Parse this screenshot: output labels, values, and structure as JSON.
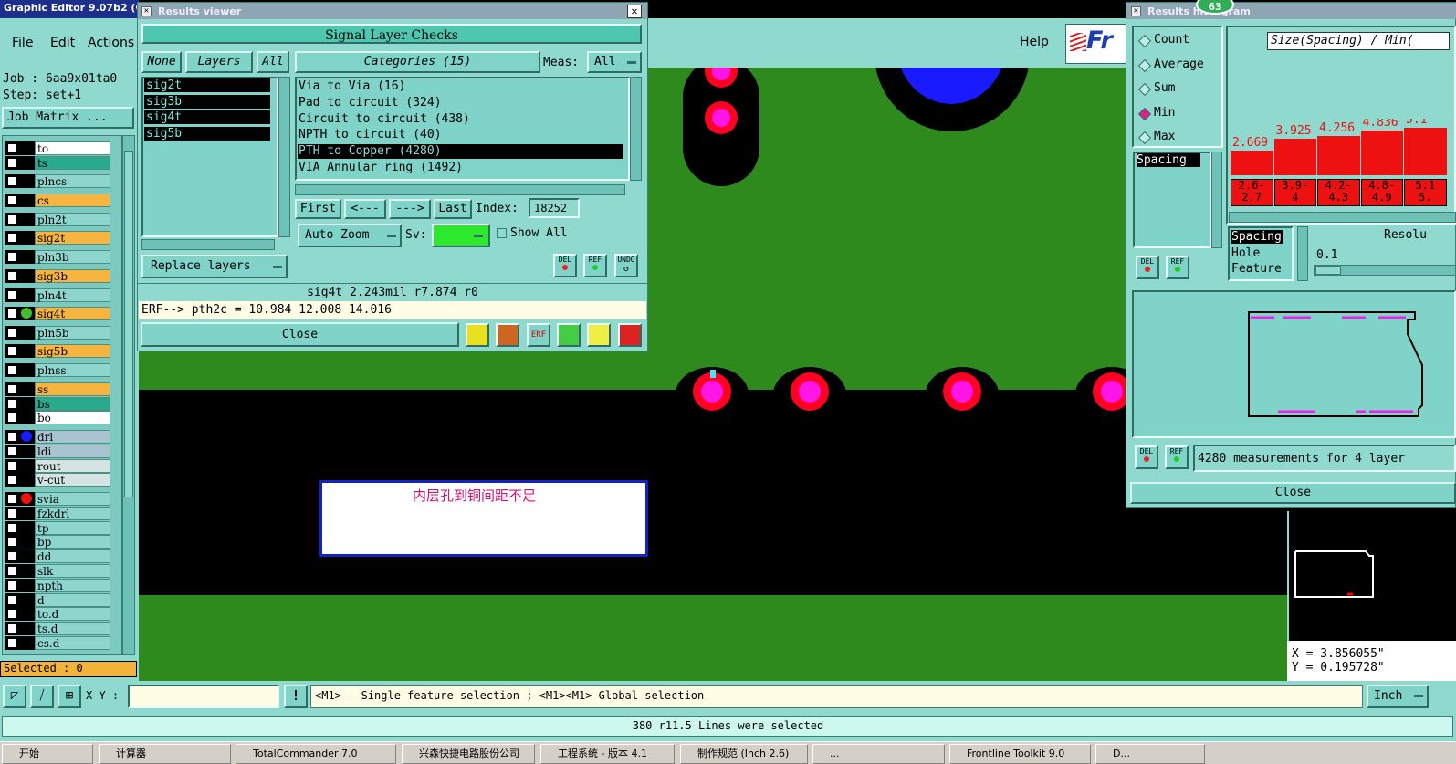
{
  "main": {
    "title": "Graphic Editor 9.07b2 (C",
    "menu": [
      "File",
      "Edit",
      "Actions"
    ],
    "help": "Help",
    "logo": "Fr",
    "job": "Job : 6aa9x01ta0",
    "step": "Step: set+1",
    "job_matrix": "Job Matrix ...",
    "layers": [
      {
        "name": "to",
        "color": "#ffffff"
      },
      {
        "name": "ts",
        "color": "#2aa98c"
      },
      {
        "name": "plncs",
        "color": "#8ed6cd"
      },
      {
        "name": "cs",
        "color": "#f7b43f"
      },
      {
        "name": "pln2t",
        "color": "#8ed6cd"
      },
      {
        "name": "sig2t",
        "color": "#f7b43f"
      },
      {
        "name": "pln3b",
        "color": "#8ed6cd"
      },
      {
        "name": "sig3b",
        "color": "#f7b43f"
      },
      {
        "name": "pln4t",
        "color": "#8ed6cd"
      },
      {
        "name": "sig4t",
        "color": "#f7b43f"
      },
      {
        "name": "pln5b",
        "color": "#8ed6cd"
      },
      {
        "name": "sig5b",
        "color": "#f7b43f"
      },
      {
        "name": "plnss",
        "color": "#8ed6cd"
      },
      {
        "name": "ss",
        "color": "#f7b43f"
      },
      {
        "name": "bs",
        "color": "#2aa98c"
      },
      {
        "name": "bo",
        "color": "#ffffff"
      },
      {
        "name": "drl",
        "color": "#a9c2cf"
      },
      {
        "name": "ldi",
        "color": "#a9c2cf"
      },
      {
        "name": "rout",
        "color": "#d5e3e3"
      },
      {
        "name": "v-cut",
        "color": "#d5e3e3"
      },
      {
        "name": "svia",
        "color": "#8ed6cd"
      },
      {
        "name": "fzkdrl",
        "color": "#8ed6cd"
      },
      {
        "name": "tp",
        "color": "#8ed6cd"
      },
      {
        "name": "bp",
        "color": "#8ed6cd"
      },
      {
        "name": "dd",
        "color": "#8ed6cd"
      },
      {
        "name": "slk",
        "color": "#8ed6cd"
      },
      {
        "name": "npth",
        "color": "#8ed6cd"
      },
      {
        "name": "d",
        "color": "#8ed6cd"
      },
      {
        "name": "to.d",
        "color": "#8ed6cd"
      },
      {
        "name": "ts.d",
        "color": "#8ed6cd"
      },
      {
        "name": "cs.d",
        "color": "#8ed6cd"
      }
    ],
    "selected": "Selected : 0",
    "xy_label": "X Y :",
    "xy_value": "",
    "hint": "<M1> - Single feature selection ; <M1><M1> Global selection",
    "units": "Inch",
    "status": "380 r11.5 Lines were selected",
    "coord_x": "X = 3.856055\"",
    "coord_y": "Y = 0.195728\"",
    "annotation": "内层孔到铜间距不足",
    "badge": "63",
    "taskbar": [
      "开始",
      "计算器",
      "TotalCommander 7.0",
      "兴森快捷电路股份公司",
      "工程系统 - 版本 4.1",
      "制作规范 (Inch 2.6)",
      "...",
      "Frontline Toolkit 9.0",
      "D..."
    ]
  },
  "results_viewer": {
    "title": "Results viewer",
    "header": "Signal Layer Checks",
    "none_btn": "None",
    "layers_label": "Layers",
    "all_btn": "All",
    "layer_list": [
      "sig2t",
      "sig3b",
      "sig4t",
      "sig5b"
    ],
    "categories_label": "Categories (15)",
    "meas_label": "Meas:",
    "meas_value": "All",
    "categories": [
      "Via to Via (16)",
      "Pad to circuit (324)",
      "Circuit to circuit (438)",
      "NPTH to circuit (40)",
      "PTH to Copper (4280)",
      "VIA Annular ring (1492)"
    ],
    "selected_category": 4,
    "first": "First",
    "prev": "<---",
    "next": "--->",
    "last": "Last",
    "index_label": "Index:",
    "index_value": "18252",
    "auto_zoom": "Auto Zoom",
    "sv_label": "Sv:",
    "show_all": "Show All",
    "replace_layers": "Replace layers",
    "del": "DEL",
    "ref": "REF",
    "undo": "UNDO",
    "info": "sig4t 2.243mil  r7.874  r0",
    "erf": "ERF--> pth2c = 10.984 12.008 14.016",
    "close": "Close"
  },
  "histogram": {
    "title": "Results histogram",
    "modes": [
      "Count",
      "Average",
      "Sum",
      "Min",
      "Max"
    ],
    "active_mode": "Min",
    "chart_title": "Size(Spacing) / Min(",
    "bar_values": [
      "2.669",
      "3.925",
      "4.256",
      "4.836",
      "5.1"
    ],
    "bin_labels": [
      "2.6-\n2.7",
      "3.9-\n4",
      "4.2-\n4.3",
      "4.8-\n4.9",
      "5.1\n5."
    ],
    "list": [
      "Spacing"
    ],
    "types": [
      "Spacing",
      "Hole",
      "Feature"
    ],
    "resolution_label": "Resolu",
    "resolution_value": "0.1",
    "measurements": "4280 measurements for 4 layer",
    "close": "Close",
    "del": "DEL",
    "ref": "REF"
  },
  "colors": {
    "board_green": "#2f8a1e",
    "pad_magenta": "#ff16e6",
    "pad_red": "#ff0022",
    "via_blue": "#1a1aff",
    "panel_teal": "#7fd3c8"
  }
}
